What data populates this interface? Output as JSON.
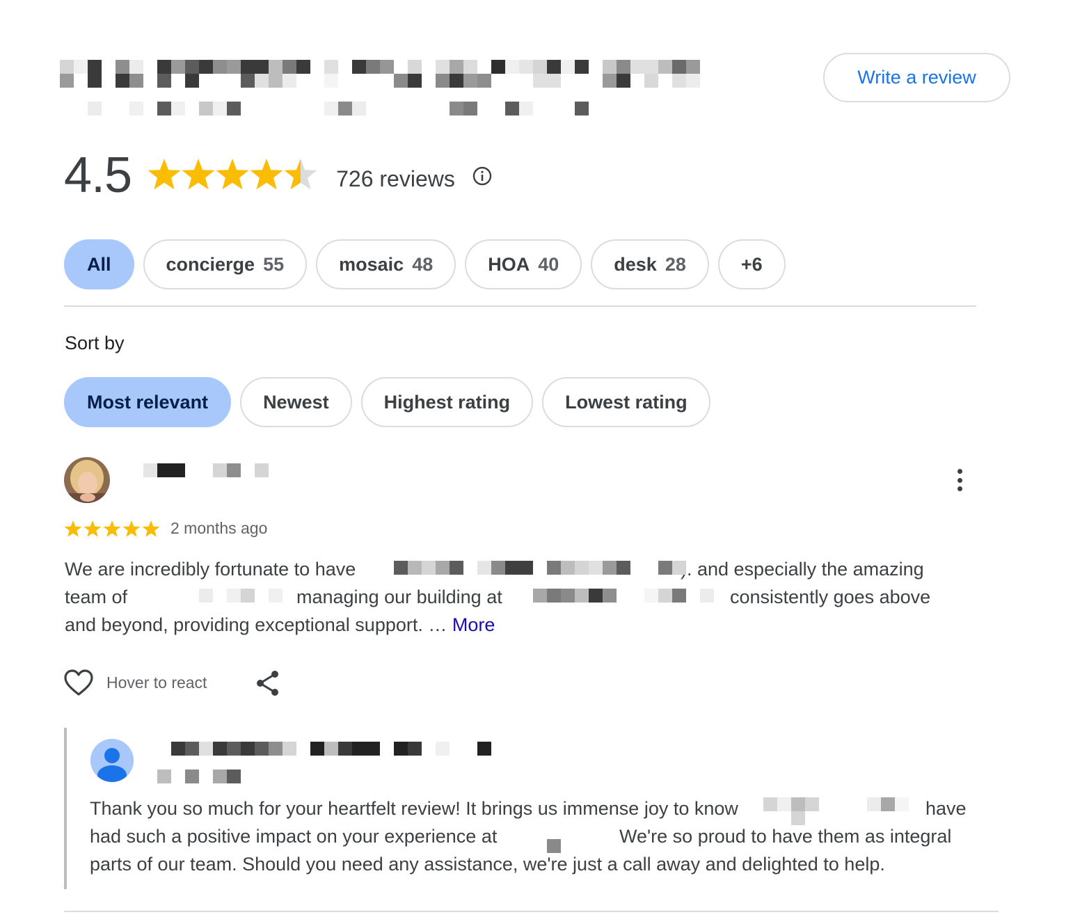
{
  "header": {
    "write_review_label": "Write a review"
  },
  "summary": {
    "rating": "4.5",
    "rating_value": 4.5,
    "review_count": "726 reviews",
    "star_color": "#fbbc04"
  },
  "topics": [
    {
      "label": "All",
      "count": "",
      "active": true
    },
    {
      "label": "concierge",
      "count": "55",
      "active": false
    },
    {
      "label": "mosaic",
      "count": "48",
      "active": false
    },
    {
      "label": "HOA",
      "count": "40",
      "active": false
    },
    {
      "label": "desk",
      "count": "28",
      "active": false
    },
    {
      "label": "+6",
      "count": "",
      "active": false
    }
  ],
  "sort": {
    "label": "Sort by",
    "options": [
      "Most relevant",
      "Newest",
      "Highest rating",
      "Lowest rating"
    ],
    "selected": "Most relevant"
  },
  "review": {
    "stars": 5,
    "time": "2 months ago",
    "lines": [
      "We are incredibly fortunate to have",
      "). and especially the amazing",
      "team of",
      "managing our building at",
      "consistently goes above",
      "and beyond, providing exceptional support. …"
    ],
    "more_label": "More",
    "react_label": "Hover to react"
  },
  "owner_reply": {
    "lines": [
      "Thank you so much for your heartfelt review! It brings us immense joy to know",
      "have",
      "had such a positive impact on your experience at",
      "We're so proud to have them as integral",
      "parts of our team. Should you need any assistance, we're just a call away and delighted to help."
    ]
  },
  "icons": {
    "info": "info-icon",
    "more": "more-vert-icon",
    "heart": "heart-outline-icon",
    "share": "share-icon",
    "person": "person-icon"
  }
}
